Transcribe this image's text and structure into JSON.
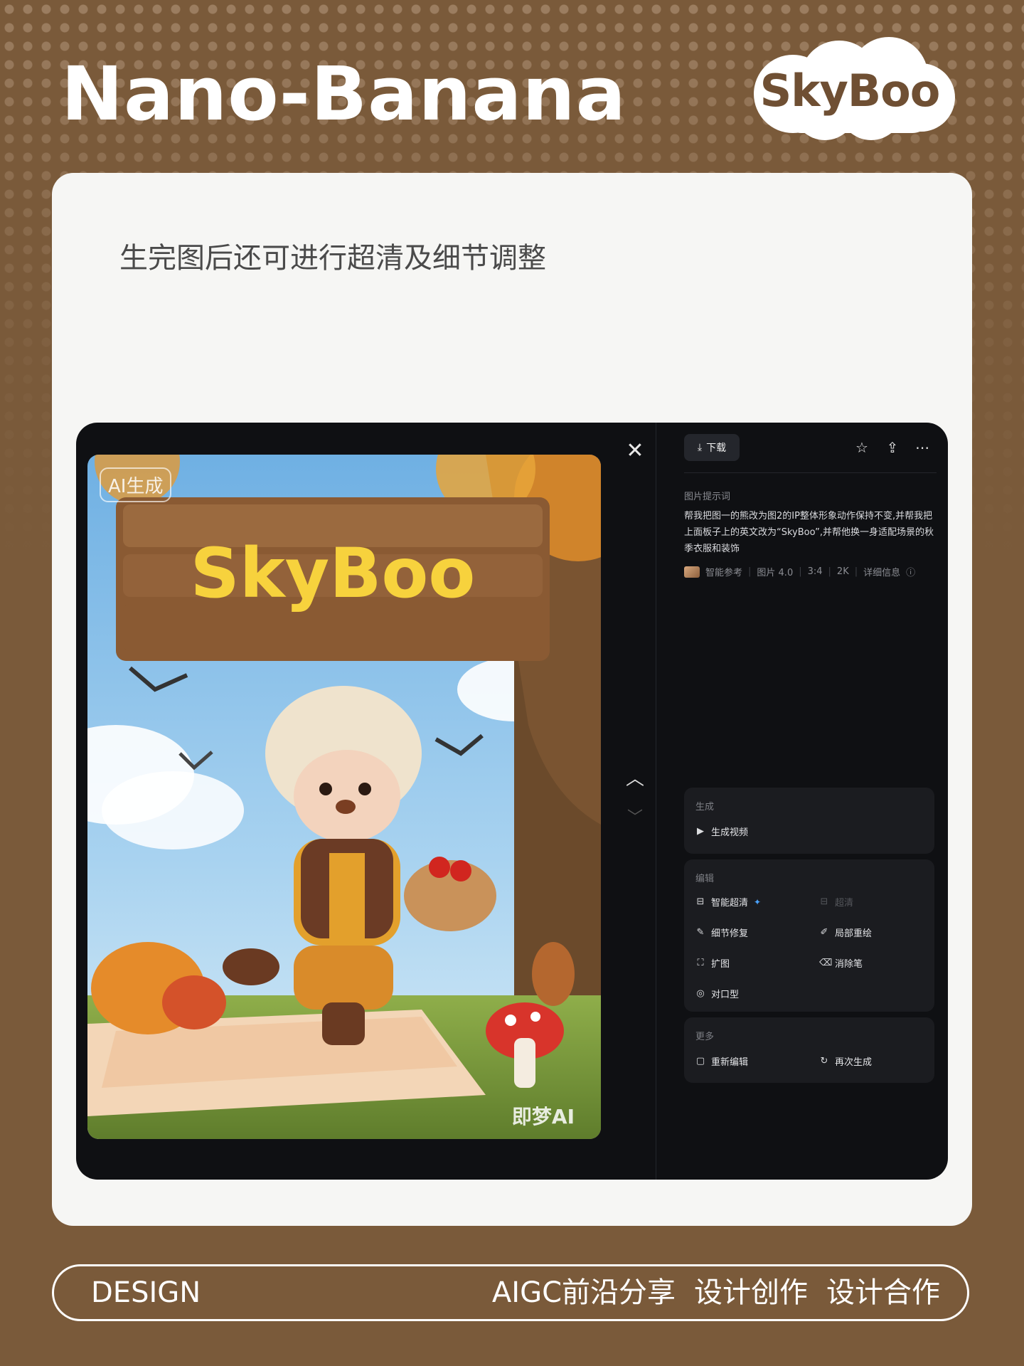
{
  "header": {
    "title": "Nano-Banana",
    "logo_text": "SkyBoo"
  },
  "card": {
    "subtitle": "生完图后还可进行超清及细节调整"
  },
  "app": {
    "image": {
      "ai_tag": "AI生成",
      "sign_text": "SkyBoo",
      "watermark": "即梦AI"
    },
    "close_icon": "close-icon",
    "panel": {
      "download_label": "下载",
      "prompt_label": "图片提示词",
      "prompt_text": "帮我把图一的熊改为图2的IP整体形象动作保持不变,并帮我把上面板子上的英文改为“SkyBoo”,并帮他换一身适配场景的秋季衣服和装饰",
      "meta": {
        "ref": "智能参考",
        "model": "图片 4.0",
        "ratio": "3:4",
        "resolution": "2K",
        "details": "详细信息"
      },
      "sections": {
        "generate": {
          "title": "生成",
          "items": [
            "生成视频"
          ]
        },
        "edit": {
          "title": "编辑",
          "items": [
            "智能超清",
            "超清",
            "细节修复",
            "局部重绘",
            "扩图",
            "消除笔",
            "对口型"
          ]
        },
        "more": {
          "title": "更多",
          "items": [
            "重新编辑",
            "再次生成"
          ]
        }
      }
    }
  },
  "footer": {
    "left": "DESIGN",
    "right": [
      "AIGC前沿分享",
      "设计创作",
      "设计合作"
    ]
  },
  "colors": {
    "background": "#7a5a3a",
    "card": "#f6f6f4",
    "app_dark": "#0f1013",
    "panel_section": "#1b1c20",
    "accent_blue": "#4aa3ff"
  }
}
